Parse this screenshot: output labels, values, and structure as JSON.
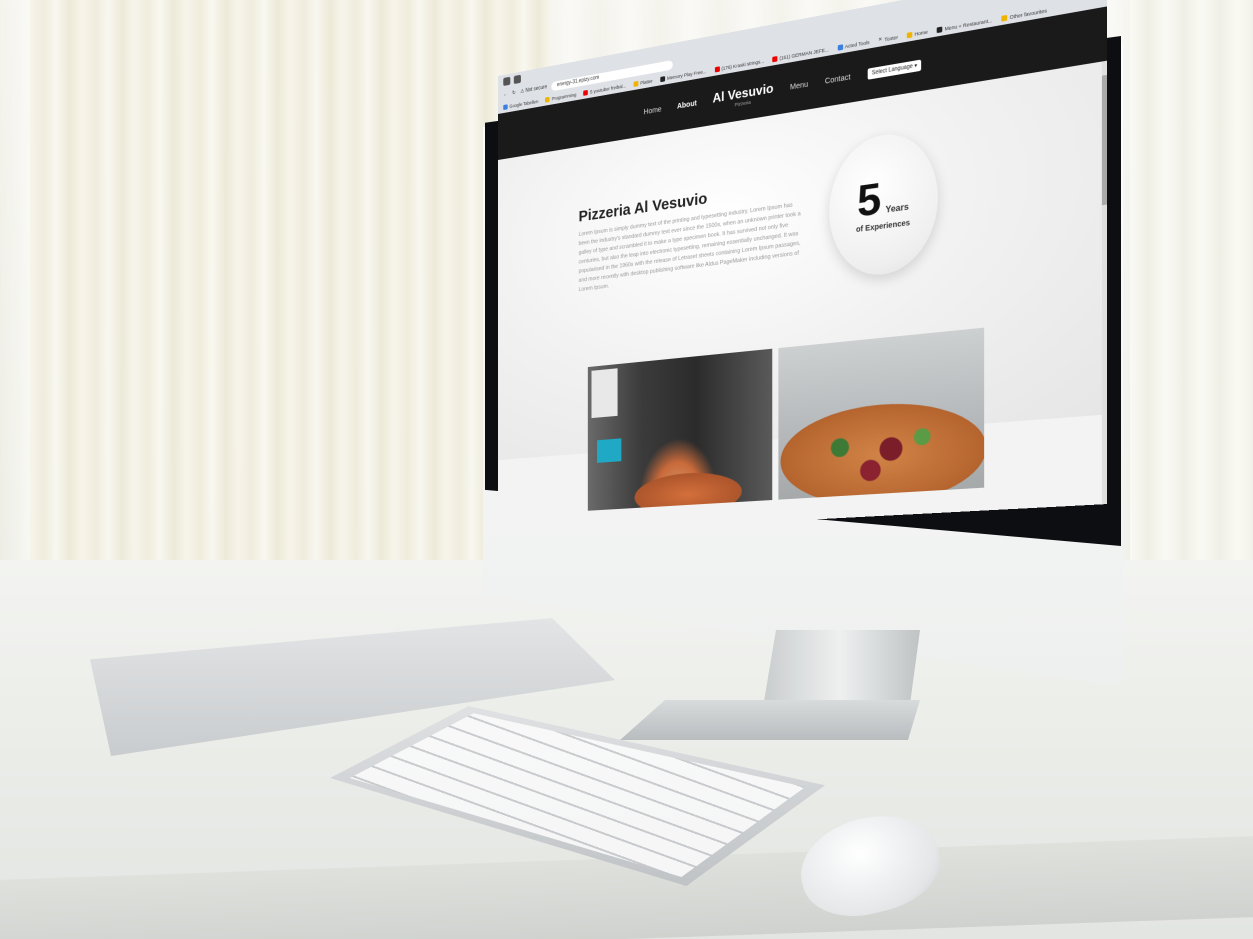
{
  "browser": {
    "security_label": "Not secure",
    "address": "energy-31.epizy.com",
    "bookmarks": [
      {
        "label": "Google Tabellen",
        "icon": "sheets-icon"
      },
      {
        "label": "Programming",
        "icon": "folder-icon"
      },
      {
        "label": "5 youtuber freibal...",
        "icon": "youtube-icon"
      },
      {
        "label": "Platter",
        "icon": "folder-icon"
      },
      {
        "label": "Memory Play Free...",
        "icon": "game-icon"
      },
      {
        "label": "(176) Kraski strings...",
        "icon": "youtube-icon"
      },
      {
        "label": "(151) GERMAN JEFE...",
        "icon": "youtube-icon"
      },
      {
        "label": "Acted Tools",
        "icon": "app-icon"
      },
      {
        "label": "Tooter",
        "icon": "x-icon"
      },
      {
        "label": "Home",
        "icon": "folder-icon"
      },
      {
        "label": "Menu « Restaurant...",
        "icon": "page-icon"
      }
    ],
    "other_favourites": "Other favourites"
  },
  "site": {
    "nav": {
      "home": "Home",
      "about": "About",
      "brand_title": "Al Vesuvio",
      "brand_sub": "Pizzeria",
      "menu": "Menu",
      "contact": "Contact",
      "language": "Select Language ▾"
    },
    "hero": {
      "title": "Pizzeria Al Vesuvio",
      "text": "Lorem Ipsum is simply dummy text of the printing and typesetting industry. Lorem Ipsum has been the industry's standard dummy text ever since the 1500s, when an unknown printer took a galley of type and scrambled it to make a type specimen book. It has survived not only five centuries, but also the leap into electronic typesetting, remaining essentially unchanged. It was popularised in the 1960s with the release of Letraset sheets containing Lorem Ipsum passages, and more recently with desktop publishing software like Aldus PageMaker including versions of Lorem Ipsum."
    },
    "badge": {
      "number": "5",
      "years": "Years",
      "sub": "of Experiences"
    }
  }
}
